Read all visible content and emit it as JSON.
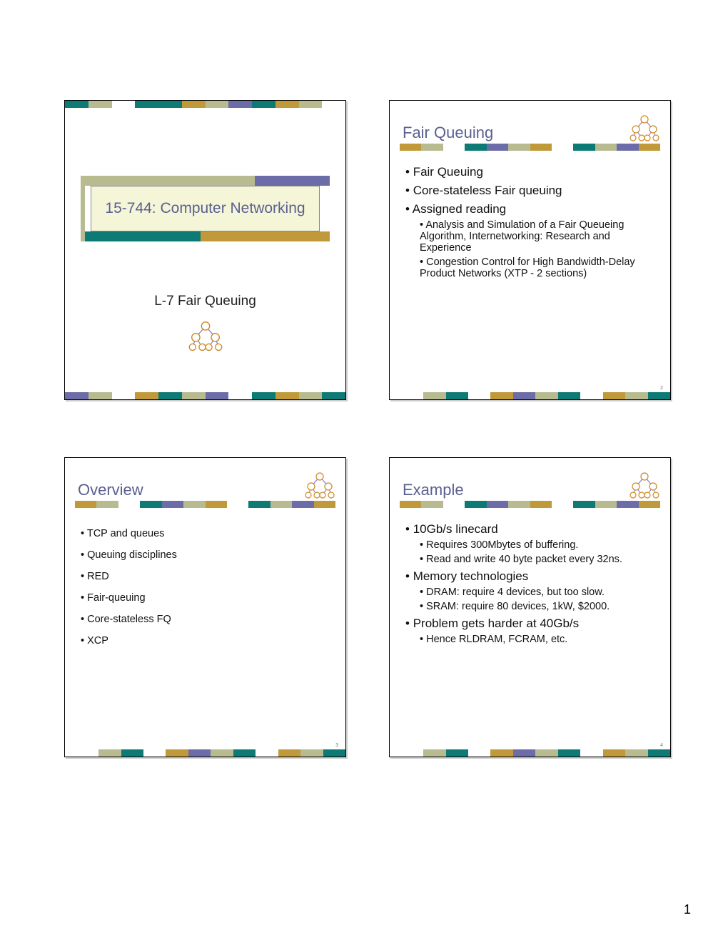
{
  "page_number": "1",
  "slides": {
    "title": {
      "main": "15-744: Computer Networking",
      "subtitle": "L-7 Fair Queuing"
    },
    "s2": {
      "title": "Fair Queuing",
      "num": "2",
      "bullets": {
        "b1": "Fair Queuing",
        "b2": "Core-stateless Fair queuing",
        "b3": "Assigned reading",
        "b3a": "Analysis and Simulation of a Fair Queueing Algorithm, Internetworking: Research and Experience",
        "b3b": "Congestion Control for High Bandwidth-Delay Product Networks (XTP - 2 sections)"
      }
    },
    "s3": {
      "title": "Overview",
      "num": "3",
      "bullets": {
        "b1": "TCP and queues",
        "b2": "Queuing disciplines",
        "b3": "RED",
        "b4": "Fair-queuing",
        "b5": "Core-stateless FQ",
        "b6": "XCP"
      }
    },
    "s4": {
      "title": "Example",
      "num": "4",
      "bullets": {
        "b1": "10Gb/s linecard",
        "b1a": "Requires 300Mbytes of buffering.",
        "b1b": "Read and write 40 byte packet every 32ns.",
        "b2": "Memory technologies",
        "b2a": "DRAM: require 4 devices, but too slow.",
        "b2b": "SRAM: require 80 devices, 1kW, $2000.",
        "b3": "Problem gets harder at 40Gb/s",
        "b3a": "Hence RLDRAM, FCRAM, etc."
      }
    }
  }
}
